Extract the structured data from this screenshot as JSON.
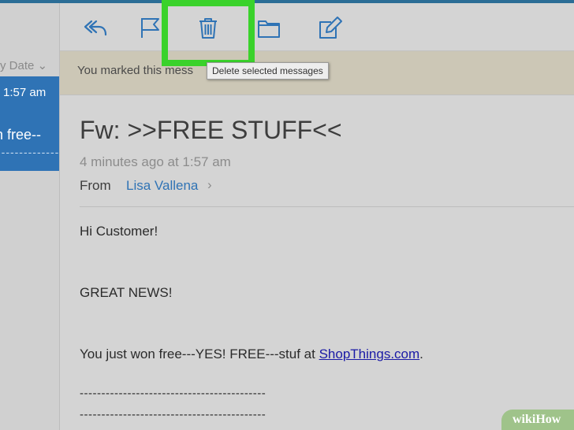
{
  "sidebar": {
    "sort_label": "y Date ⌄",
    "selected_message": {
      "time": "1:57 am",
      "snippet": "n free--",
      "dashes": "--------------"
    }
  },
  "toolbar": {
    "icons": [
      "reply-icon",
      "flag-icon",
      "trash-icon",
      "folder-icon",
      "compose-icon"
    ],
    "tooltip": "Delete selected messages",
    "accent_color": "#2f73b5",
    "highlight_color": "#3ad22b"
  },
  "banner": {
    "text": "You marked this mess"
  },
  "email": {
    "subject": "Fw: >>FREE STUFF<<",
    "datetime": "4 minutes ago at 1:57 am",
    "from_label": "From",
    "from_name": "Lisa Vallena",
    "from_chevron": "›",
    "greeting": "Hi Customer!",
    "headline": "GREAT NEWS!",
    "body_prefix": "You just won free---YES! FREE---stuf at ",
    "link_text": "ShopThings.com",
    "body_suffix": ".",
    "dash_line_1": "-------------------------------------------",
    "dash_line_2": "-------------------------------------------"
  },
  "watermark": {
    "text": "wikiHow"
  }
}
